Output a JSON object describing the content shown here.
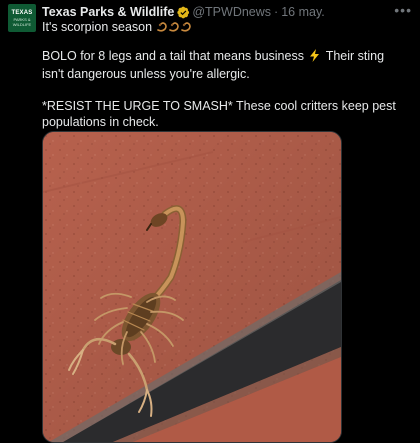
{
  "account": {
    "name": "Texas Parks & Wildlife",
    "handle": "@TPWDnews",
    "date": "16 may.",
    "separator": "·",
    "avatar_text": [
      "TEXAS",
      "PARKS &",
      "WILDLIFE"
    ],
    "verified_icon": "verified-badge-icon"
  },
  "tweet": {
    "line1": "It's scorpion season",
    "line1_emoji": "scorpion-emoji",
    "para1a": "BOLO for 8 legs and a tail that means business",
    "para1_emoji": "high-voltage-emoji",
    "para1b": "Their sting isn't dangerous unless you're allergic.",
    "para2": "*RESIST THE URGE TO SMASH* These cool critters keep pest populations in check."
  },
  "media": {
    "image": "scorpion-on-brick-photo"
  },
  "menu": {
    "more_label": "•••"
  },
  "colors": {
    "background": "#000000",
    "text": "#e7e9ea",
    "muted": "#71767b",
    "verified": "#e2b719",
    "brick": "#b7614d"
  }
}
